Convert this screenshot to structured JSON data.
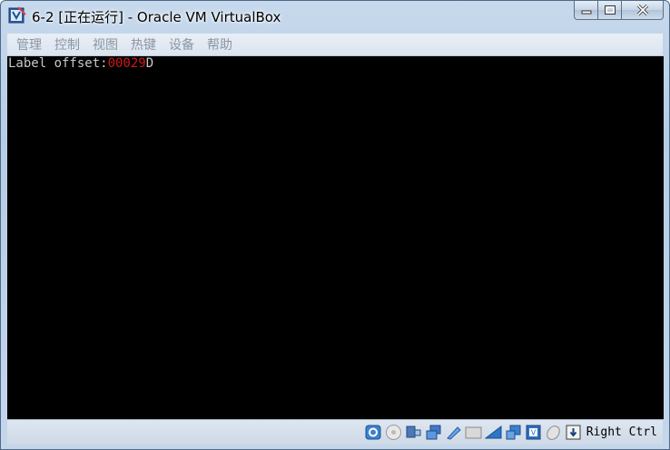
{
  "window": {
    "title": "6-2 [正在运行] - Oracle VM VirtualBox"
  },
  "menubar": {
    "items": [
      {
        "label": "管理"
      },
      {
        "label": "控制"
      },
      {
        "label": "视图"
      },
      {
        "label": "热键"
      },
      {
        "label": "设备"
      },
      {
        "label": "帮助"
      }
    ]
  },
  "console": {
    "label_text": "Label offset:",
    "value_text": "00029",
    "suffix_text": "D",
    "colors": {
      "text": "#c8c8c8",
      "value": "#d01818",
      "background": "#000000"
    }
  },
  "statusbar": {
    "icons": [
      "hard-disk-icon",
      "optical-disk-icon",
      "usb-icon",
      "network-icon",
      "shared-folders-icon",
      "display-icon",
      "video-capture-icon",
      "guest-additions-icon",
      "cpu-icon",
      "mouse-integration-icon",
      "keyboard-capture-icon"
    ],
    "host_key": "Right Ctrl"
  }
}
